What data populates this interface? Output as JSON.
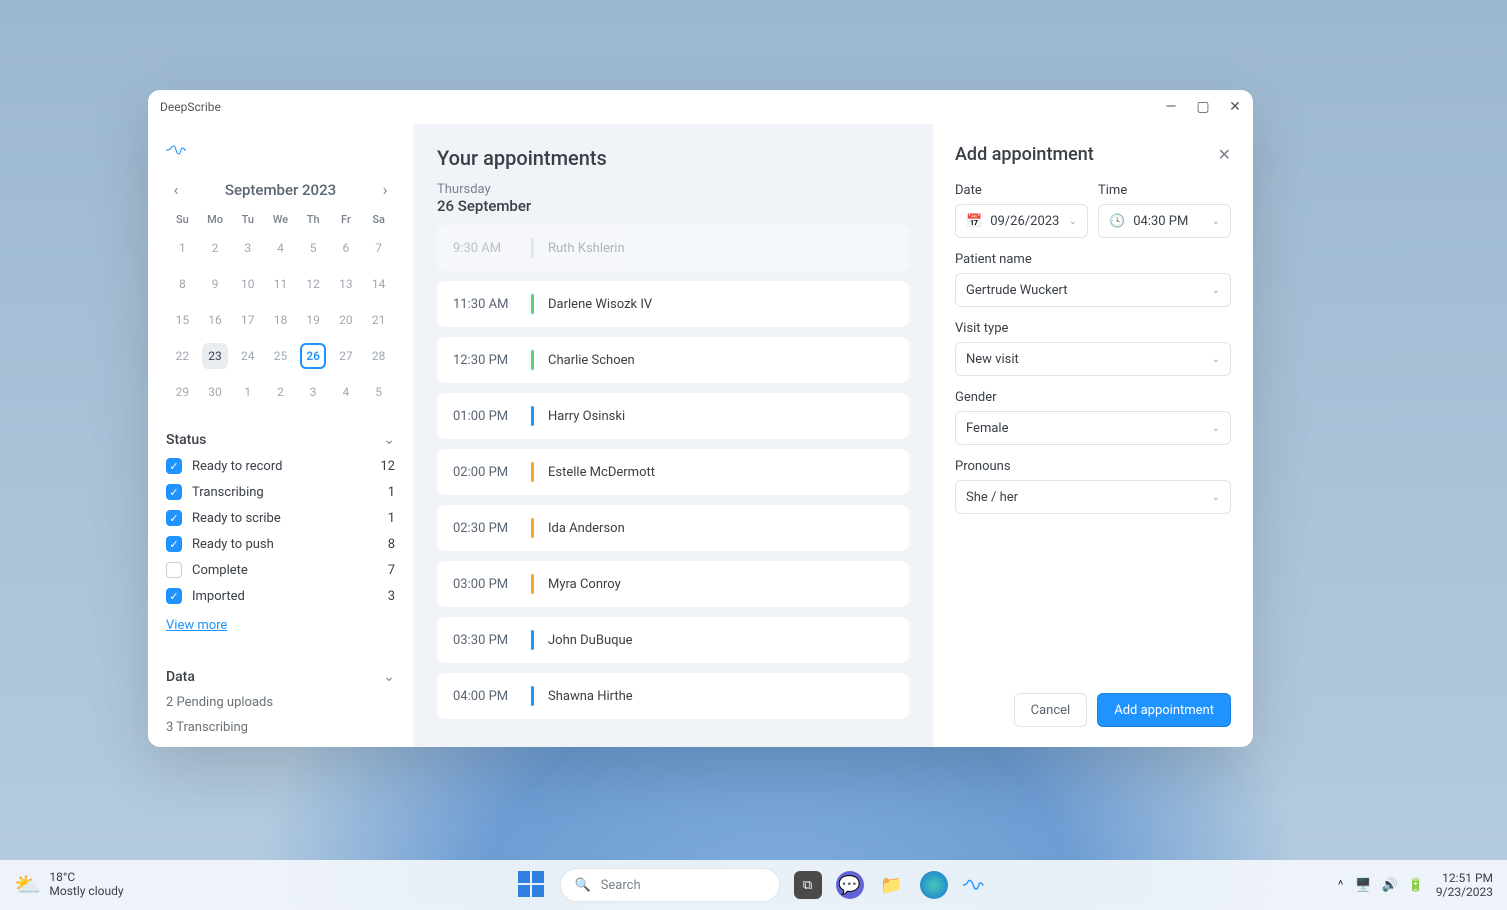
{
  "window": {
    "title": "DeepScribe"
  },
  "calendar": {
    "title": "September 2023",
    "weekdays": [
      "Su",
      "Mo",
      "Tu",
      "We",
      "Th",
      "Fr",
      "Sa"
    ],
    "weeks": [
      [
        {
          "d": "1"
        },
        {
          "d": "2"
        },
        {
          "d": "3"
        },
        {
          "d": "4"
        },
        {
          "d": "5"
        },
        {
          "d": "6"
        },
        {
          "d": "7"
        }
      ],
      [
        {
          "d": "8"
        },
        {
          "d": "9"
        },
        {
          "d": "10"
        },
        {
          "d": "11"
        },
        {
          "d": "12"
        },
        {
          "d": "13"
        },
        {
          "d": "14"
        }
      ],
      [
        {
          "d": "15"
        },
        {
          "d": "16"
        },
        {
          "d": "17"
        },
        {
          "d": "18"
        },
        {
          "d": "19"
        },
        {
          "d": "20"
        },
        {
          "d": "21"
        }
      ],
      [
        {
          "d": "22"
        },
        {
          "d": "23",
          "today": true
        },
        {
          "d": "24"
        },
        {
          "d": "25"
        },
        {
          "d": "26",
          "selected": true
        },
        {
          "d": "27"
        },
        {
          "d": "28"
        }
      ],
      [
        {
          "d": "29"
        },
        {
          "d": "30"
        },
        {
          "d": "1"
        },
        {
          "d": "2"
        },
        {
          "d": "3"
        },
        {
          "d": "4"
        },
        {
          "d": "5"
        }
      ]
    ]
  },
  "status": {
    "header": "Status",
    "items": [
      {
        "label": "Ready to record",
        "count": "12",
        "checked": true
      },
      {
        "label": "Transcribing",
        "count": "1",
        "checked": true
      },
      {
        "label": "Ready to scribe",
        "count": "1",
        "checked": true
      },
      {
        "label": "Ready to push",
        "count": "8",
        "checked": true
      },
      {
        "label": "Complete",
        "count": "7",
        "checked": false
      },
      {
        "label": "Imported",
        "count": "3",
        "checked": true
      }
    ],
    "view_more": "View more"
  },
  "data": {
    "header": "Data",
    "items": [
      "2 Pending uploads",
      "3 Transcribing"
    ]
  },
  "main": {
    "title": "Your appointments",
    "day_of_week": "Thursday",
    "date_label": "26 September",
    "appointments": [
      {
        "time": "9:30 AM",
        "name": "Ruth Kshlerin",
        "color": "#c8d0d8",
        "faded": true
      },
      {
        "time": "11:30 AM",
        "name": "Darlene Wisozk IV",
        "color": "#5bd17b"
      },
      {
        "time": "12:30 PM",
        "name": "Charlie Schoen",
        "color": "#5bd17b"
      },
      {
        "time": "01:00 PM",
        "name": "Harry Osinski",
        "color": "#1f93ff"
      },
      {
        "time": "02:00 PM",
        "name": "Estelle McDermott",
        "color": "#f5a623"
      },
      {
        "time": "02:30 PM",
        "name": "Ida Anderson",
        "color": "#f5a623"
      },
      {
        "time": "03:00 PM",
        "name": "Myra Conroy",
        "color": "#f5a623"
      },
      {
        "time": "03:30 PM",
        "name": "John DuBuque",
        "color": "#1f93ff"
      },
      {
        "time": "04:00 PM",
        "name": "Shawna Hirthe",
        "color": "#1f93ff"
      }
    ]
  },
  "panel": {
    "title": "Add appointment",
    "labels": {
      "date": "Date",
      "time": "Time",
      "patient": "Patient name",
      "visit": "Visit type",
      "gender": "Gender",
      "pronouns": "Pronouns"
    },
    "values": {
      "date": "09/26/2023",
      "time": "04:30 PM",
      "patient": "Gertrude Wuckert",
      "visit": "New visit",
      "gender": "Female",
      "pronouns": "She / her"
    },
    "cancel": "Cancel",
    "submit": "Add appointment"
  },
  "taskbar": {
    "weather_temp": "18°C",
    "weather_desc": "Mostly cloudy",
    "search_placeholder": "Search",
    "time": "12:51 PM",
    "date": "9/23/2023"
  },
  "colors": {
    "accent": "#1f93ff"
  }
}
